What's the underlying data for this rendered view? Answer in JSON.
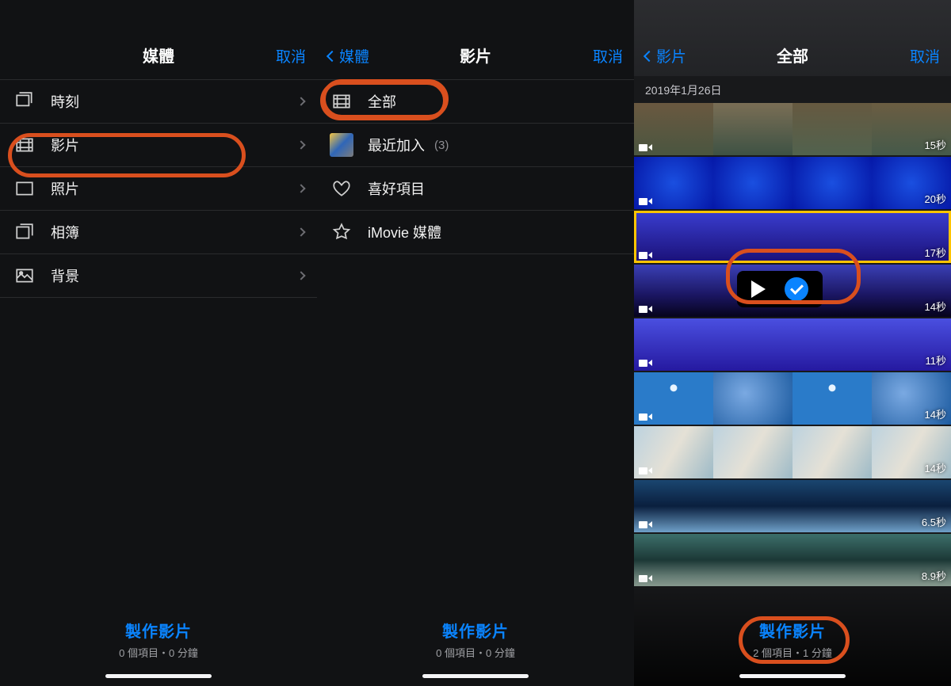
{
  "cancel_label": "取消",
  "panel1": {
    "title": "媒體",
    "rows": [
      {
        "icon": "moments",
        "label": "時刻"
      },
      {
        "icon": "video",
        "label": "影片"
      },
      {
        "icon": "photo",
        "label": "照片"
      },
      {
        "icon": "album",
        "label": "相簿"
      },
      {
        "icon": "bg",
        "label": "背景"
      }
    ],
    "footer": {
      "create": "製作影片",
      "sub": "0 個項目・0 分鐘"
    }
  },
  "panel2": {
    "back": "媒體",
    "title": "影片",
    "rows": [
      {
        "icon": "video",
        "label": "全部"
      },
      {
        "icon": "thumb",
        "label": "最近加入",
        "count": "(3)"
      },
      {
        "icon": "heart",
        "label": "喜好項目"
      },
      {
        "icon": "star",
        "label": "iMovie 媒體"
      }
    ],
    "footer": {
      "create": "製作影片",
      "sub": "0 個項目・0 分鐘"
    }
  },
  "panel3": {
    "back": "影片",
    "title": "全部",
    "date": "2019年1月26日",
    "clips": [
      {
        "dur": "15秒",
        "style": "g-rock"
      },
      {
        "dur": "20秒",
        "style": "g-blue"
      },
      {
        "dur": "17秒",
        "style": "g-jelly",
        "selected": true
      },
      {
        "dur": "14秒",
        "style": "g-jdark",
        "popup": true
      },
      {
        "dur": "11秒",
        "style": "g-jlit"
      },
      {
        "dur": "14秒",
        "style": "g-jelly2"
      },
      {
        "dur": "14秒",
        "style": "g-wave"
      },
      {
        "dur": "6.5秒",
        "style": "g-peng"
      },
      {
        "dur": "8.9秒",
        "style": "g-seal"
      }
    ],
    "footer": {
      "create": "製作影片",
      "sub": "2 個項目・1 分鐘"
    }
  }
}
